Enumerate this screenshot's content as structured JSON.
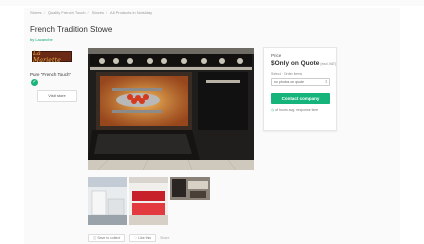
{
  "topbar": {
    "link": ""
  },
  "breadcrumb": [
    "Stores",
    "Quality French Touch",
    "Stoves",
    "All Products in Noisiday"
  ],
  "product": {
    "title": "French Tradition Stowe",
    "byline": "by Lacanche"
  },
  "seller": {
    "logo_text": "La Mariette",
    "name": "Pure \"French Touch\"",
    "verified_icon": "check-circle-icon",
    "visit_label": "Visit store"
  },
  "gallery": {
    "images": [
      "range-cooker-oven-open",
      "white-kitchen",
      "red-kitchen",
      "kitchen-detail"
    ]
  },
  "actions": {
    "save_label": "Save to collect",
    "share_label": "Like this",
    "note": "Share"
  },
  "price_card": {
    "label": "Price",
    "price": "$Only on Quote",
    "unit": "(excl.VAT)",
    "select_label": "Select · Order items",
    "select_value": "no photos on quote",
    "contact_label": "Contact company",
    "response_text": "of hours avg. response time"
  },
  "colors": {
    "accent": "#14b47a",
    "logo_bg": "#6b2a16"
  }
}
